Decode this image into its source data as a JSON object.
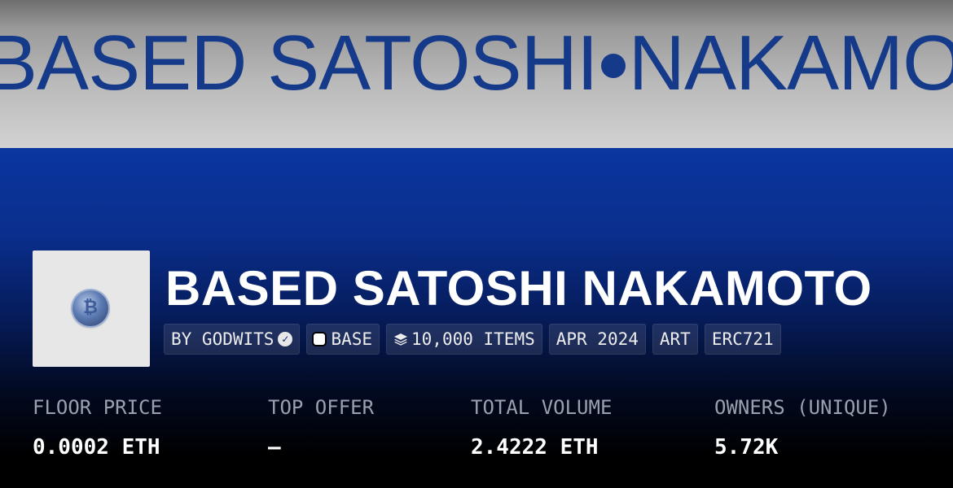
{
  "banner": {
    "text_left": "BASED SATOSHI",
    "text_right": "NAKAMOTO"
  },
  "collection": {
    "name": "BASED SATOSHI NAKAMOTO",
    "avatar_icon": "bitcoin-coin-icon",
    "avatar_glyph": "₿"
  },
  "tags": {
    "creator": "BY GODWITS",
    "creator_icon": "verified-icon",
    "verified_glyph": "✓",
    "chain": "BASE",
    "chain_icon": "base-chain-icon",
    "items": "10,000 ITEMS",
    "items_icon": "layers-icon",
    "date": "APR 2024",
    "category": "ART",
    "standard": "ERC721"
  },
  "stats": [
    {
      "label": "FLOOR PRICE",
      "value": "0.0002 ETH"
    },
    {
      "label": "TOP OFFER",
      "value": "—"
    },
    {
      "label": "TOTAL VOLUME",
      "value": "2.4222 ETH"
    },
    {
      "label": "OWNERS (UNIQUE)",
      "value": "5.72K"
    }
  ],
  "colors": {
    "banner_text": "#153a8a",
    "hero_blue": "#0a36a0",
    "background_dark": "#000000",
    "label_gray": "#9aa0ad",
    "value_white": "#ffffff"
  }
}
